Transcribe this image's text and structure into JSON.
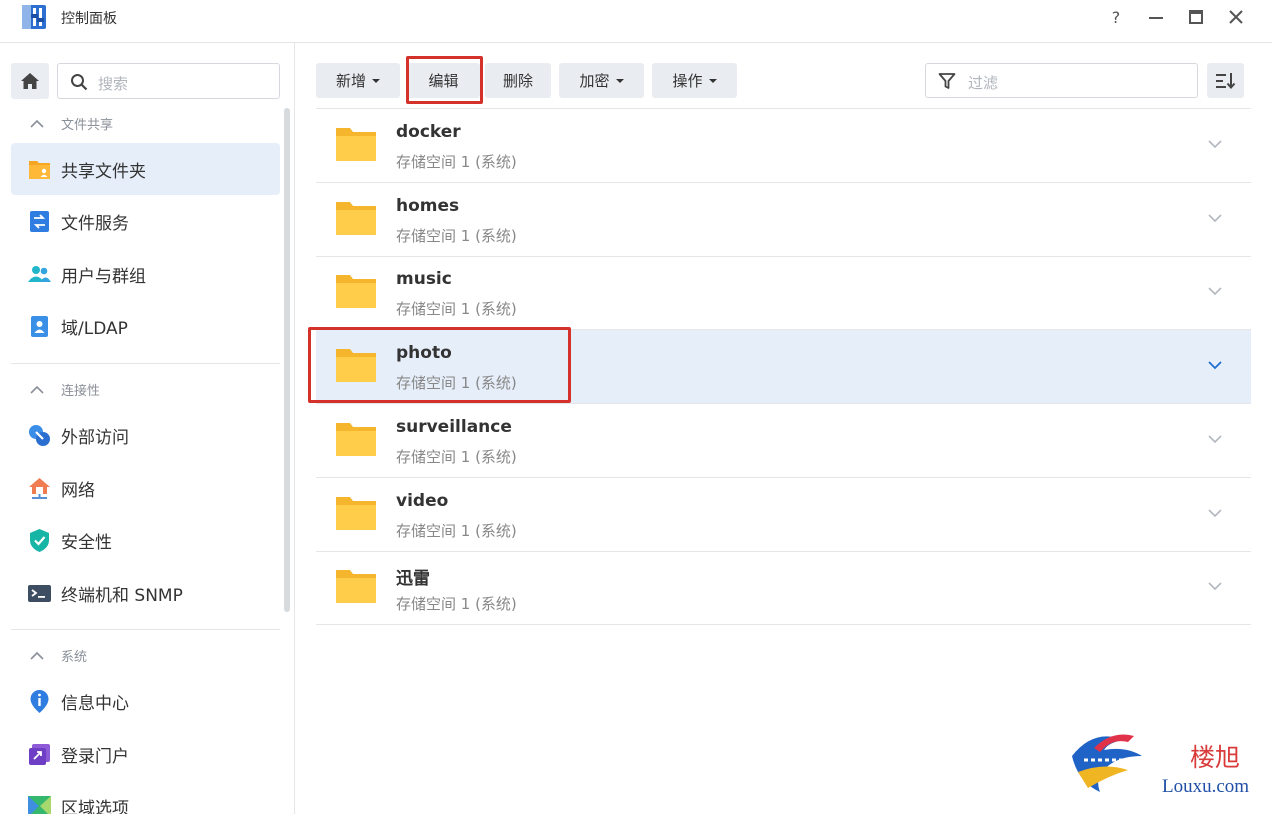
{
  "window": {
    "title": "控制面板",
    "help_label": "?"
  },
  "sidebar": {
    "search_placeholder": "搜索",
    "sections": [
      {
        "title": "文件共享",
        "items": [
          {
            "label": "共享文件夹",
            "icon": "shared-folder-icon",
            "active": true
          },
          {
            "label": "文件服务",
            "icon": "file-services-icon"
          },
          {
            "label": "用户与群组",
            "icon": "users-groups-icon"
          },
          {
            "label": "域/LDAP",
            "icon": "domain-ldap-icon"
          }
        ]
      },
      {
        "title": "连接性",
        "items": [
          {
            "label": "外部访问",
            "icon": "external-access-icon"
          },
          {
            "label": "网络",
            "icon": "network-icon"
          },
          {
            "label": "安全性",
            "icon": "security-shield-icon"
          },
          {
            "label": "终端机和 SNMP",
            "icon": "terminal-icon"
          }
        ]
      },
      {
        "title": "系统",
        "items": [
          {
            "label": "信息中心",
            "icon": "info-center-icon"
          },
          {
            "label": "登录门户",
            "icon": "login-portal-icon"
          },
          {
            "label": "区域选项",
            "icon": "regional-options-icon"
          }
        ]
      }
    ]
  },
  "toolbar": {
    "create_label": "新增",
    "edit_label": "编辑",
    "delete_label": "删除",
    "encrypt_label": "加密",
    "action_label": "操作",
    "filter_placeholder": "过滤"
  },
  "folders": [
    {
      "name": "docker",
      "location": "存储空间 1 (系统)"
    },
    {
      "name": "homes",
      "location": "存储空间 1 (系统)"
    },
    {
      "name": "music",
      "location": "存储空间 1 (系统)"
    },
    {
      "name": "photo",
      "location": "存储空间 1 (系统)",
      "selected": true
    },
    {
      "name": "surveillance",
      "location": "存储空间 1 (系统)"
    },
    {
      "name": "video",
      "location": "存储空间 1 (系统)"
    },
    {
      "name": "迅雷",
      "location": "存储空间 1 (系统)"
    }
  ],
  "watermark": {
    "cn": "楼旭",
    "en": "Louxu.com"
  },
  "colors": {
    "highlight": "#d4312b",
    "selected_row": "#e6eef9",
    "folder": "#ffc940",
    "accent": "#1f6fd0"
  }
}
